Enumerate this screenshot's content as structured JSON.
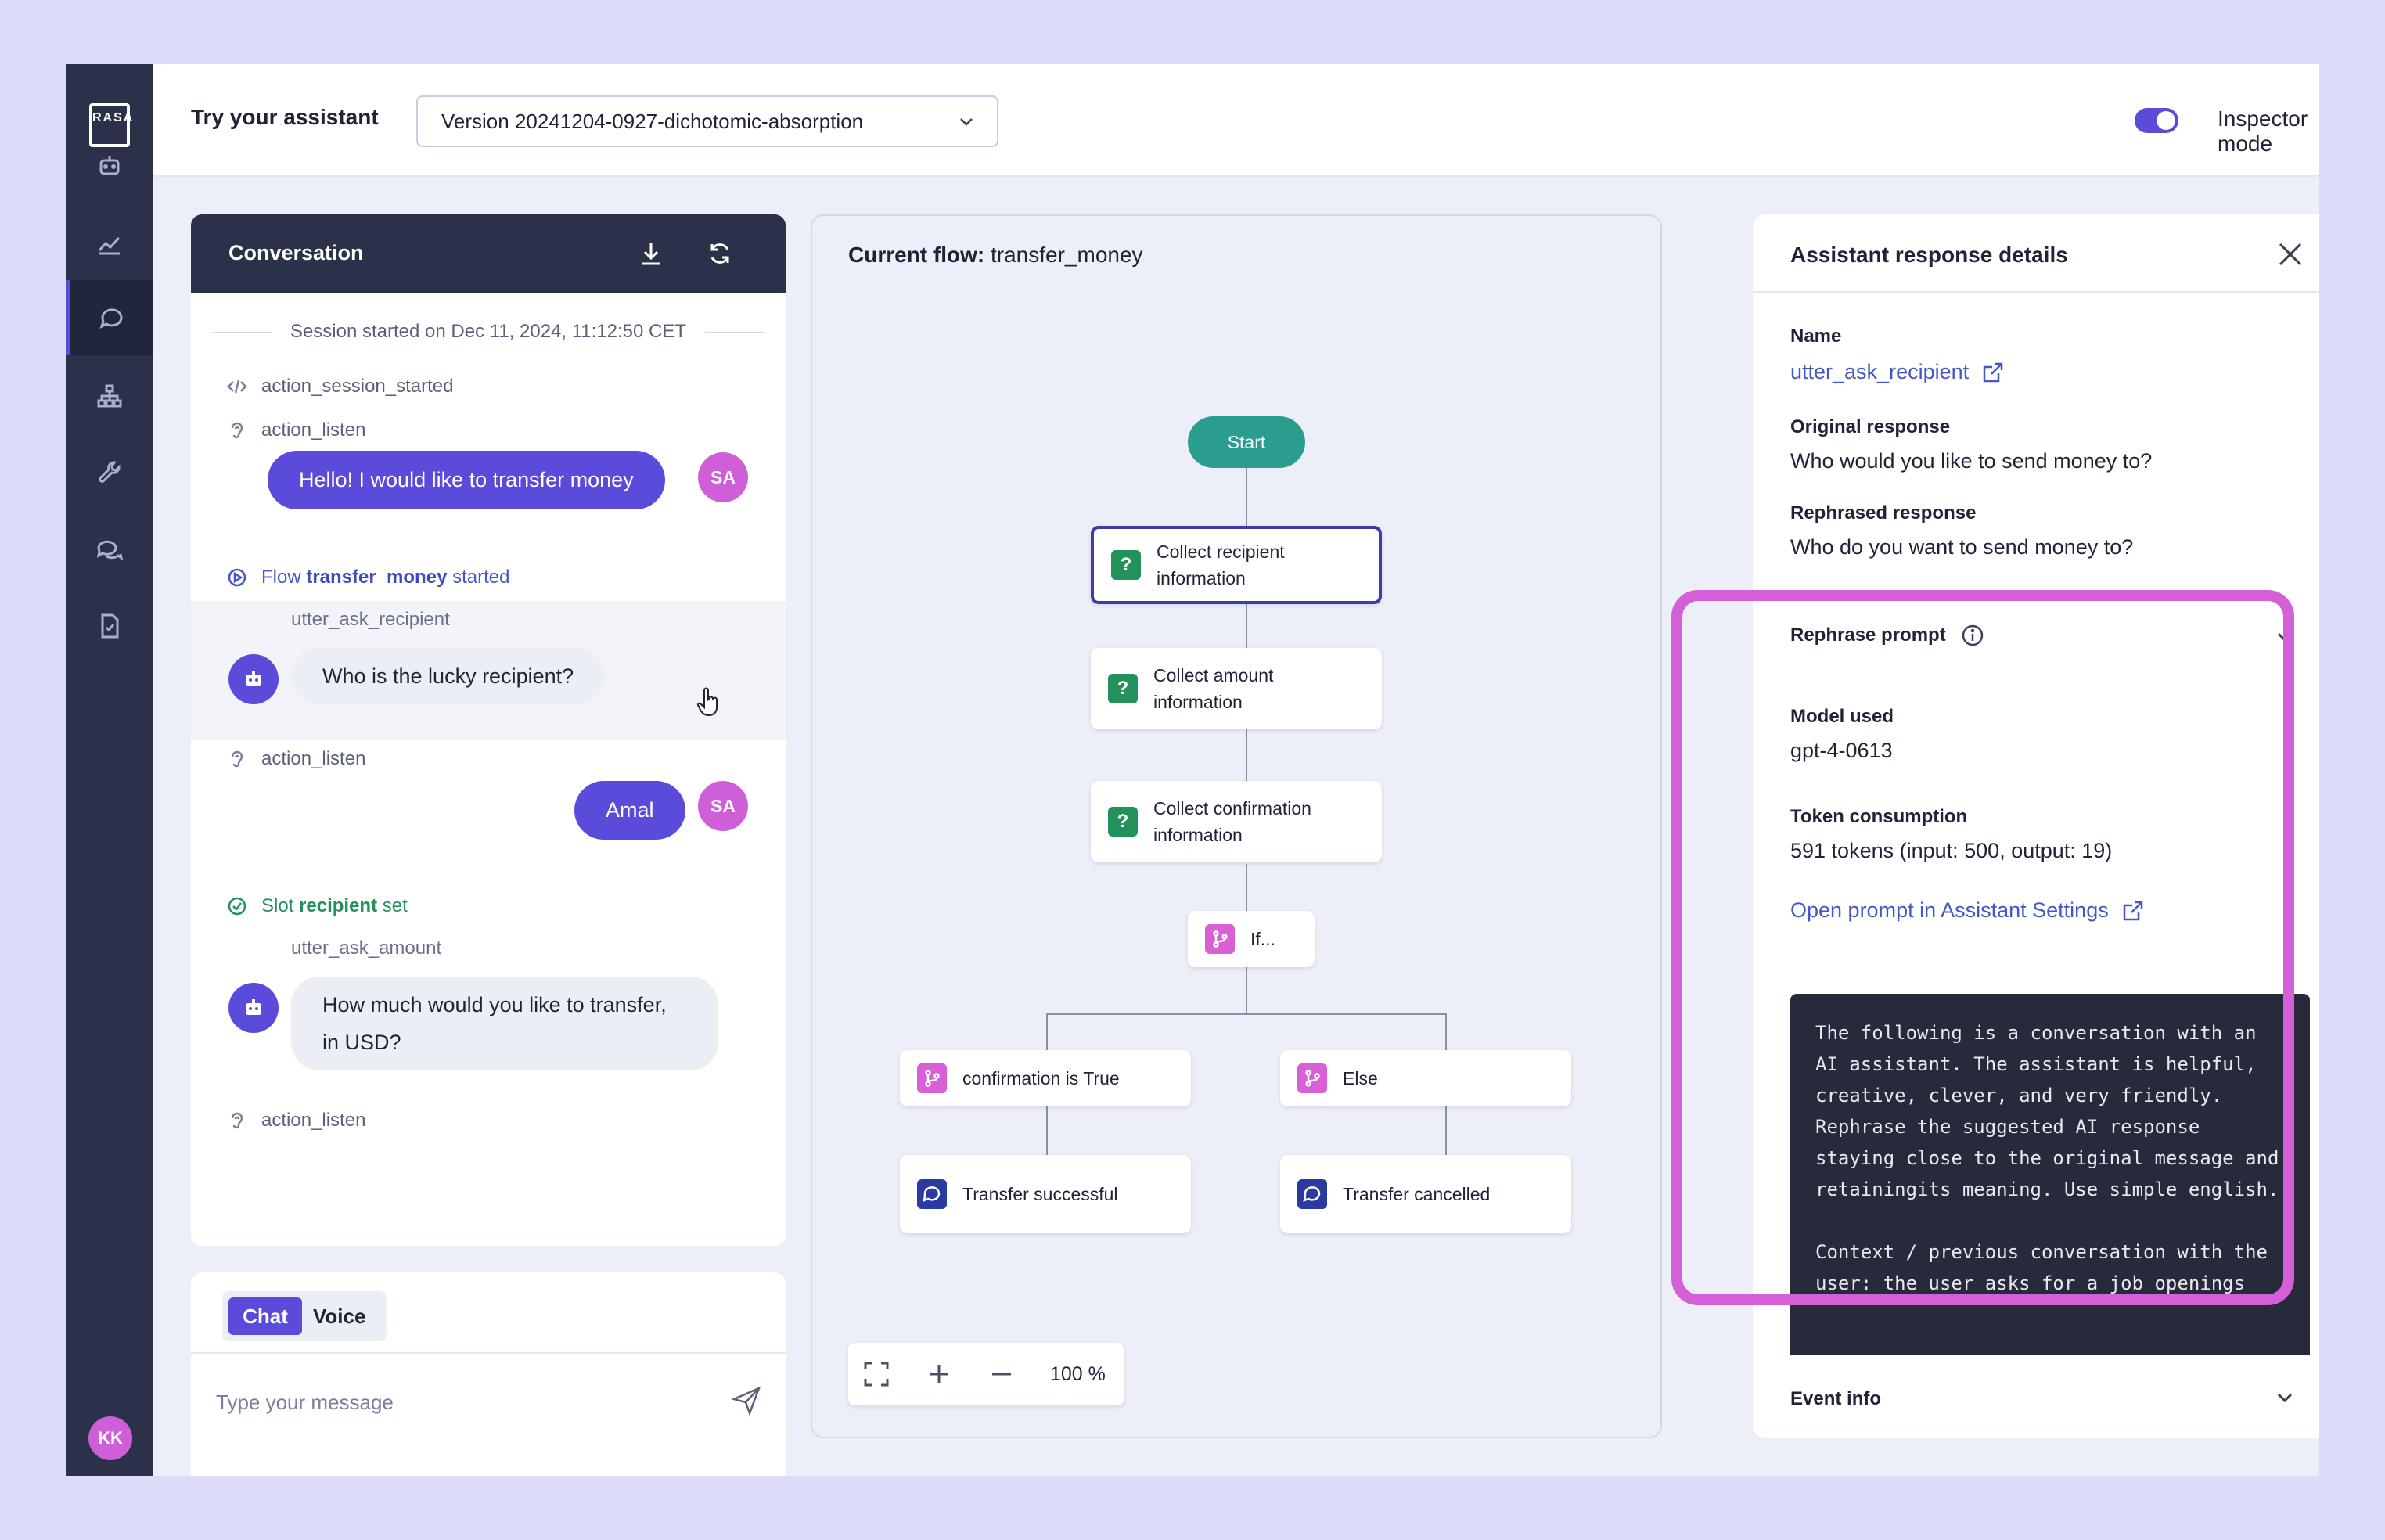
{
  "topbar": {
    "title": "Try your assistant",
    "version_select": "Version 20241204-0927-dichotomic-absorption",
    "inspector_label": "Inspector mode",
    "inspector_on": true
  },
  "sidebar": {
    "logo_text": "RASA",
    "items": [
      "assistant-icon",
      "analytics-icon",
      "chat-icon",
      "flows-icon",
      "tools-icon",
      "responses-icon",
      "document-icon"
    ],
    "active_index": 2,
    "avatar": "KK"
  },
  "conversation": {
    "title": "Conversation",
    "session": "Session started on Dec 11, 2024, 11:12:50 CET",
    "events": {
      "session_started": "action_session_started",
      "listen_1": "action_listen",
      "listen_2": "action_listen",
      "listen_3": "action_listen"
    },
    "user_msg_1": "Hello! I would like to transfer money",
    "user_msg_2": "Amal",
    "user_initials": "SA",
    "flow_started_prefix": "Flow",
    "flow_started_name": "transfer_money",
    "flow_started_suffix": "started",
    "bot_1": {
      "name": "utter_ask_recipient",
      "text": "Who is the lucky recipient?"
    },
    "slot_prefix": "Slot",
    "slot_name": "recipient",
    "slot_suffix": "set",
    "bot_2": {
      "name": "utter_ask_amount",
      "text": "How much would you like to transfer, in USD?"
    }
  },
  "composer": {
    "tab_chat": "Chat",
    "tab_voice": "Voice",
    "placeholder": "Type your message"
  },
  "flow": {
    "title_prefix": "Current flow:",
    "title_name": "transfer_money",
    "start": "Start",
    "node_recipient": "Collect recipient information",
    "node_amount": "Collect amount information",
    "node_confirm": "Collect confirmation information",
    "node_if": "If...",
    "node_true": "confirmation is True",
    "node_else": "Else",
    "node_success": "Transfer successful",
    "node_cancel": "Transfer cancelled",
    "zoom": "100 %"
  },
  "details": {
    "title": "Assistant response details",
    "name_label": "Name",
    "name_value": "utter_ask_recipient",
    "original_label": "Original response",
    "original_value": "Who would you like to send money to?",
    "rephrased_label": "Rephrased response",
    "rephrased_value": "Who do you want to send money to?",
    "rephrase_prompt_label": "Rephrase prompt",
    "model_label": "Model used",
    "model_value": "gpt-4-0613",
    "tokens_label": "Token consumption",
    "tokens_value": "591 tokens (input: 500, output: 19)",
    "open_prompt_link": "Open prompt in Assistant Settings",
    "prompt_text": "The following is a conversation with an AI assistant. The assistant is helpful, creative, clever, and very friendly. Rephrase the suggested AI response staying close to the original message and  retainingits meaning. Use simple english.\n\nContext / previous conversation with the user: the user asks for a job openings",
    "event_info_label": "Event info"
  },
  "colors": {
    "accent": "#5a4bdb",
    "sidebar": "#2b3148",
    "highlight": "#d45fd6",
    "success": "#23925a"
  }
}
